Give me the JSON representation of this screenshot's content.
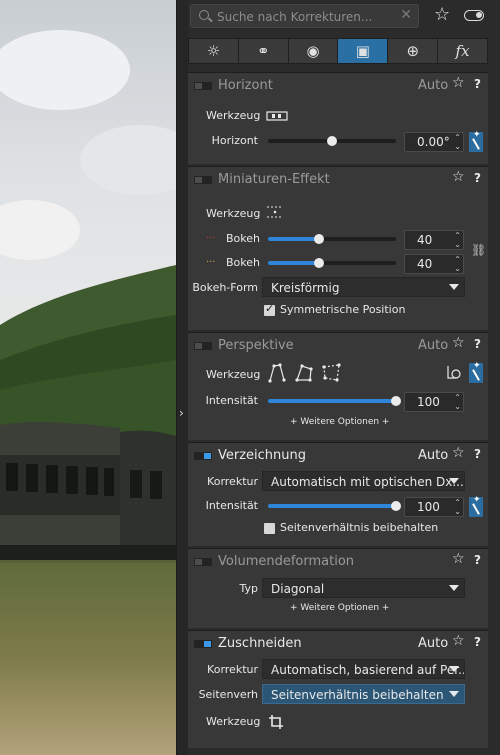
{
  "search": {
    "placeholder": "Suche nach Korrekturen..."
  },
  "icons": [
    "search-icon",
    "clear-icon",
    "star-icon",
    "toggle-icon",
    "light-icon",
    "color-icon",
    "detail-icon",
    "geometry-icon",
    "local-icon",
    "fx-icon"
  ],
  "tabs": [
    {
      "name": "light",
      "icon": "☼"
    },
    {
      "name": "color",
      "icon": "⚭"
    },
    {
      "name": "detail",
      "icon": "◉"
    },
    {
      "name": "geometry",
      "icon": "▣"
    },
    {
      "name": "local",
      "icon": "⊕"
    },
    {
      "name": "fx",
      "icon": "fx"
    }
  ],
  "accent": "#2b70a5",
  "horizont": {
    "title": "Horizont",
    "auto": "Auto",
    "enabled": false,
    "tool_label": "Werkzeug",
    "slider_label": "Horizont",
    "value": "0.00°",
    "slider_pos": 0.5
  },
  "miniatur": {
    "title": "Miniaturen-Effekt",
    "enabled": false,
    "tool_label": "Werkzeug",
    "bokeh1_label": "Bokeh",
    "bokeh1_value": "40",
    "bokeh1_pos": 0.4,
    "bokeh2_label": "Bokeh",
    "bokeh2_value": "40",
    "bokeh2_pos": 0.4,
    "form_label": "Bokeh-Form",
    "form_value": "Kreisförmig",
    "sym_label": "Symmetrische Position",
    "sym_checked": true
  },
  "perspektive": {
    "title": "Perspektive",
    "auto": "Auto",
    "enabled": false,
    "tool_label": "Werkzeug",
    "int_label": "Intensität",
    "int_value": "100",
    "int_pos": 1.0,
    "more": "+ Weitere Optionen +"
  },
  "verzeichnung": {
    "title": "Verzeichnung",
    "auto": "Auto",
    "enabled": true,
    "korr_label": "Korrektur",
    "korr_value": "Automatisch mit optischen Dx...",
    "int_label": "Intensität",
    "int_value": "100",
    "int_pos": 1.0,
    "ratio_label": "Seitenverhältnis beibehalten",
    "ratio_checked": false
  },
  "volumen": {
    "title": "Volumendeformation",
    "enabled": false,
    "typ_label": "Typ",
    "typ_value": "Diagonal",
    "more": "+ Weitere Optionen +"
  },
  "zuschneiden": {
    "title": "Zuschneiden",
    "auto": "Auto",
    "enabled": true,
    "korr_label": "Korrektur",
    "korr_value": "Automatisch, basierend auf Per...",
    "seiten_label": "Seitenverh",
    "seiten_value": "Seitenverhältnis beibehalten",
    "tool_label": "Werkzeug"
  }
}
